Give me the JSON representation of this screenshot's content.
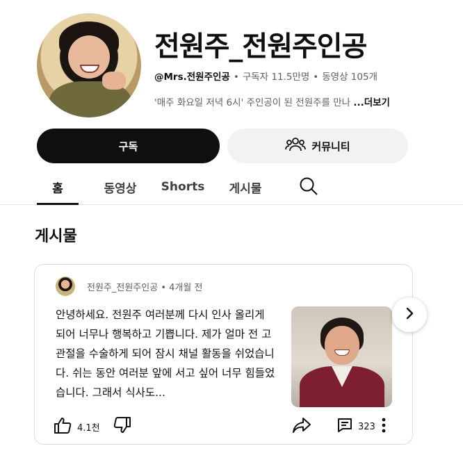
{
  "channel": {
    "title": "전원주_전원주인공",
    "handle": "@Mrs.전원주인공",
    "subscribers": "구독자 11.5만명",
    "videos": "동영상 105개",
    "description": "'매주 화요일 저녁 6시' 주인공이 된 전원주를 만나",
    "more_label": "...더보기"
  },
  "buttons": {
    "subscribe": "구독",
    "community": "커뮤니티"
  },
  "tabs": [
    {
      "label": "홈",
      "active": true
    },
    {
      "label": "동영상",
      "active": false
    },
    {
      "label": "Shorts",
      "active": false
    },
    {
      "label": "게시물",
      "active": false
    }
  ],
  "section": {
    "title": "게시물"
  },
  "post": {
    "author": "전원주_전원주인공",
    "time": "4개월 전",
    "text": "안녕하세요. 전원주 여러분께 다시 인사 올리게 되어 너무나 행복하고 기쁩니다. 제가 얼마 전 고관절을 수술하게 되어 잠시 채널 활동을 쉬었습니다. 쉬는 동안 여러분 앞에 서고 싶어 너무 힘들었습니다. 그래서 식사도...",
    "likes": "4.1천",
    "comments": "323"
  },
  "icons": {
    "community": "people-icon",
    "search": "search-icon",
    "like": "thumb-up-icon",
    "dislike": "thumb-down-icon",
    "share": "share-icon",
    "comment": "comment-icon",
    "more": "more-vert-icon",
    "next": "chevron-right-icon"
  }
}
